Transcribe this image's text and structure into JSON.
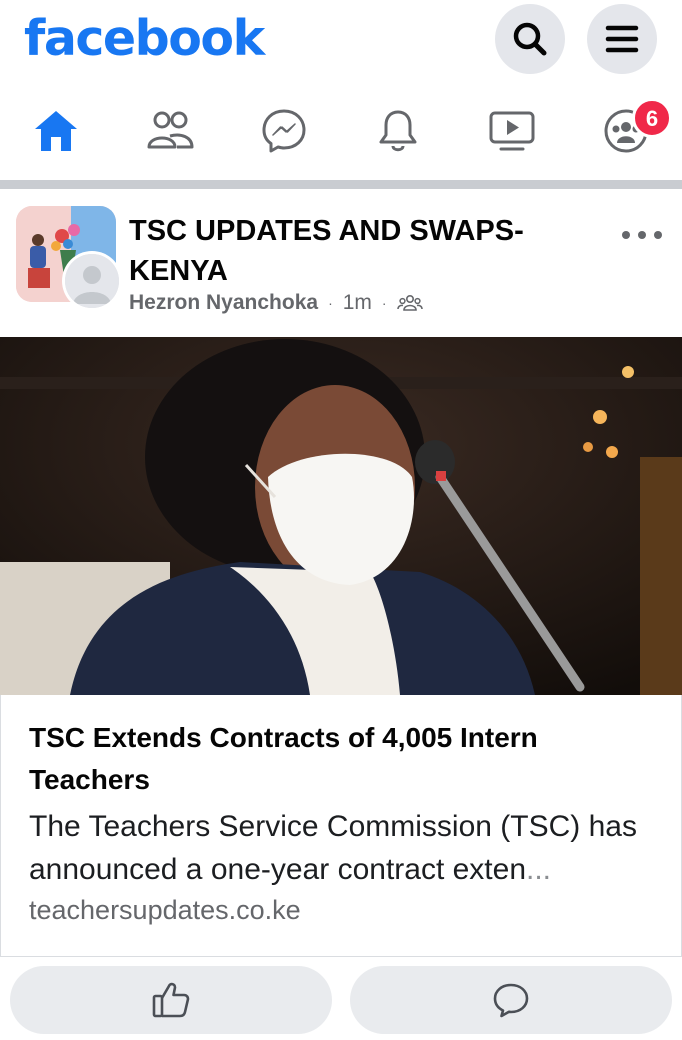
{
  "app": {
    "logo_text": "facebook",
    "brand_color": "#1877f2"
  },
  "header": {
    "search_icon": "search-icon",
    "menu_icon": "hamburger-menu-icon"
  },
  "nav": {
    "active_color": "#1877f2",
    "inactive_color": "#65676b",
    "items": [
      {
        "name": "home",
        "icon": "home-icon",
        "active": true
      },
      {
        "name": "friends",
        "icon": "friends-icon",
        "active": false
      },
      {
        "name": "messenger",
        "icon": "messenger-icon",
        "active": false
      },
      {
        "name": "notifications",
        "icon": "bell-icon",
        "active": false
      },
      {
        "name": "watch",
        "icon": "video-icon",
        "active": false
      },
      {
        "name": "groups",
        "icon": "groups-icon",
        "active": false,
        "badge": "6"
      }
    ],
    "badge_color": "#f02849"
  },
  "post": {
    "group_name": "TSC UPDATES AND SWAPS-KENYA",
    "author": "Hezron Nyanchoka",
    "separator": "·",
    "time": "1m",
    "audience_icon": "group-audience-icon",
    "more_icon": "more-options-icon",
    "link": {
      "title": "TSC Extends Contracts of 4,005 Intern Teachers",
      "description": "The Teachers Service Commission (TSC) has announced a one-year contract exten",
      "ellipsis": "...",
      "domain": "teachersupdates.co.ke"
    }
  },
  "actions": {
    "like_icon": "like-thumbs-up-icon",
    "comment_icon": "comment-icon"
  }
}
